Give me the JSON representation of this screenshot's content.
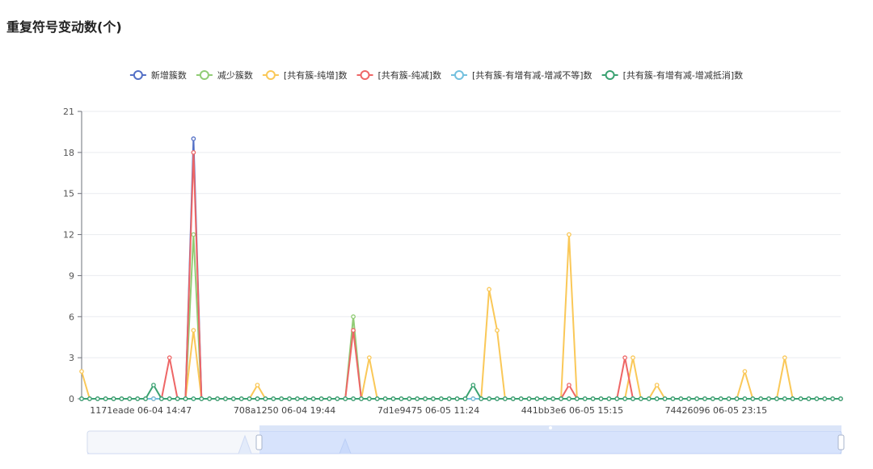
{
  "page": {
    "title": "重复符号变动数(个)"
  },
  "chart_data": {
    "type": "line",
    "yticks": [
      0,
      3,
      6,
      9,
      12,
      15,
      18,
      21
    ],
    "ylim": [
      0,
      21
    ],
    "x_label_ticks": [
      {
        "index": 7,
        "label": "1171eade 06-04 14:47"
      },
      {
        "index": 25,
        "label": "708a1250 06-04 19:44"
      },
      {
        "index": 43,
        "label": "7d1e9475 06-05 11:24"
      },
      {
        "index": 61,
        "label": "441bb3e6 06-05 15:15"
      },
      {
        "index": 79,
        "label": "74426096 06-05 23:15"
      }
    ],
    "point_count": 96,
    "legend_position": "top-center",
    "grid": true,
    "series": [
      {
        "name": "新增簇数",
        "color": "#5470c6",
        "points": {
          "14": 19
        }
      },
      {
        "name": "减少簇数",
        "color": "#91cc75",
        "points": {
          "14": 12,
          "34": 6
        }
      },
      {
        "name": "[共有簇-纯增]数",
        "color": "#fac858",
        "points": {
          "0": 2,
          "14": 5,
          "22": 1,
          "36": 3,
          "51": 8,
          "52": 5,
          "61": 12,
          "69": 3,
          "72": 1,
          "83": 2,
          "88": 3
        }
      },
      {
        "name": "[共有簇-纯减]数",
        "color": "#ee6666",
        "points": {
          "11": 3,
          "14": 18,
          "34": 5,
          "61": 1,
          "68": 3
        }
      },
      {
        "name": "[共有簇-有增有减-增减不等]数",
        "color": "#73c0de",
        "points": {}
      },
      {
        "name": "[共有簇-有增有减-增减抵消]数",
        "color": "#3ba272",
        "points": {
          "9": 1,
          "49": 1
        }
      }
    ]
  }
}
